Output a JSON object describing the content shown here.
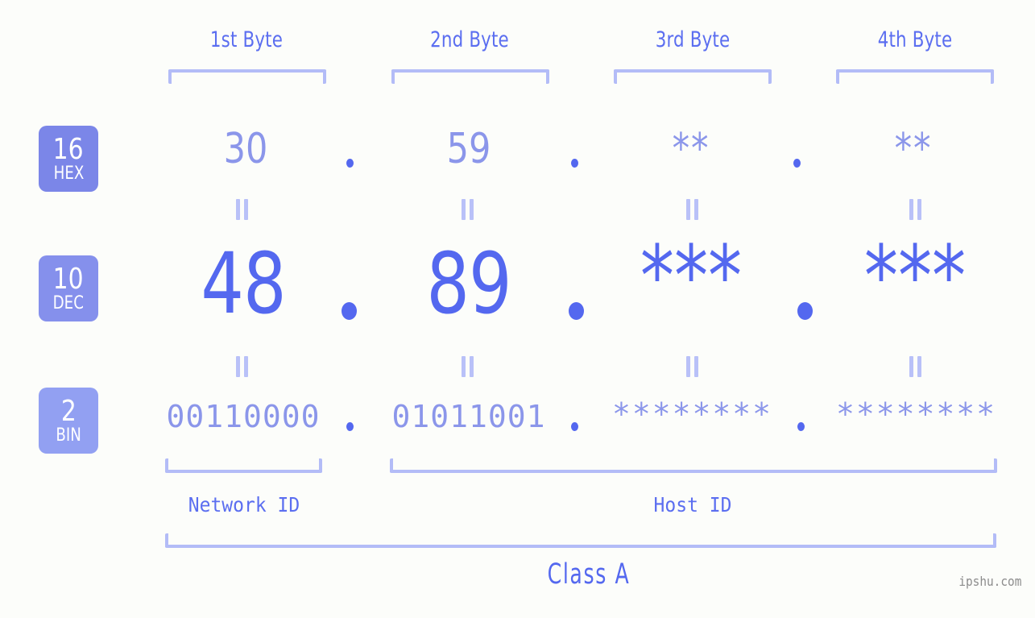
{
  "background_color": "#fcfdfa",
  "accent_color": "#5468ef",
  "accent_light": "#8b96ea",
  "bracket_color": "#b3bcf7",
  "headers": [
    {
      "label": "1st Byte"
    },
    {
      "label": "2nd Byte"
    },
    {
      "label": "3rd Byte"
    },
    {
      "label": "4th Byte"
    }
  ],
  "rows": [
    {
      "badge_number": "16",
      "badge_unit": "HEX",
      "badge_color": "#7b86e8",
      "values": [
        "30",
        "59",
        "**",
        "**"
      ],
      "separator": "."
    },
    {
      "badge_number": "10",
      "badge_unit": "DEC",
      "badge_color": "#8590ec",
      "values": [
        "48",
        "89",
        "***",
        "***"
      ],
      "separator": "."
    },
    {
      "badge_number": "2",
      "badge_unit": "BIN",
      "badge_color": "#92a0f2",
      "values": [
        "00110000",
        "01011001",
        "********",
        "********"
      ],
      "separator": "."
    }
  ],
  "equality_symbol": "=",
  "segments": {
    "network_id": "Network ID",
    "host_id": "Host ID"
  },
  "class_label": "Class A",
  "watermark": "ipshu.com"
}
